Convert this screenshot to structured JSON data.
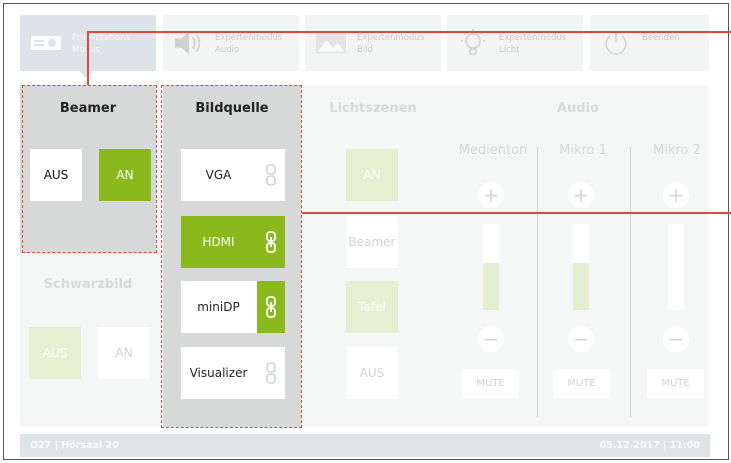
{
  "nav": [
    {
      "label": "Präsentations Modus",
      "icon": "projector-icon",
      "active": true
    },
    {
      "label": "Expertenmodus Audio",
      "icon": "speaker-icon",
      "active": false
    },
    {
      "label": "Expertenmodus Bild",
      "icon": "image-icon",
      "active": false
    },
    {
      "label": "Expertenmodus Licht",
      "icon": "lightbulb-icon",
      "active": false
    },
    {
      "label": "Beenden",
      "icon": "power-icon",
      "active": false
    }
  ],
  "beamer": {
    "title": "Beamer",
    "off": "AUS",
    "on": "AN",
    "selected": "AN"
  },
  "schwarzbild": {
    "title": "Schwarzbild",
    "off": "AUS",
    "on": "AN",
    "selected": "AUS"
  },
  "source": {
    "title": "Bildquelle",
    "items": [
      {
        "label": "VGA",
        "selected": false,
        "linked": false
      },
      {
        "label": "HDMI",
        "selected": true,
        "linked": true
      },
      {
        "label": "miniDP",
        "selected": false,
        "linked": true
      },
      {
        "label": "Visualizer",
        "selected": false,
        "linked": false
      }
    ]
  },
  "lichtszenen": {
    "title": "Lichtszenen",
    "items": [
      {
        "label": "AN",
        "selected": true
      },
      {
        "label": "Beamer",
        "selected": false
      },
      {
        "label": "Tafel",
        "selected": true
      },
      {
        "label": "AUS",
        "selected": false
      }
    ]
  },
  "audio": {
    "title": "Audio",
    "channels": [
      {
        "name": "Medienton",
        "level": 0.55,
        "mute": "MUTE"
      },
      {
        "name": "Mikro 1",
        "level": 0.55,
        "mute": "MUTE"
      },
      {
        "name": "Mikro 2",
        "level": 0.0,
        "mute": "MUTE"
      }
    ]
  },
  "footer": {
    "room": "O27 | Hörsaal 20",
    "datetime": "05.12.2017 | 11:00"
  },
  "colors": {
    "accent": "#8ab91e",
    "accent_pale": "#e6efd2",
    "annotation": "#e2463f"
  }
}
